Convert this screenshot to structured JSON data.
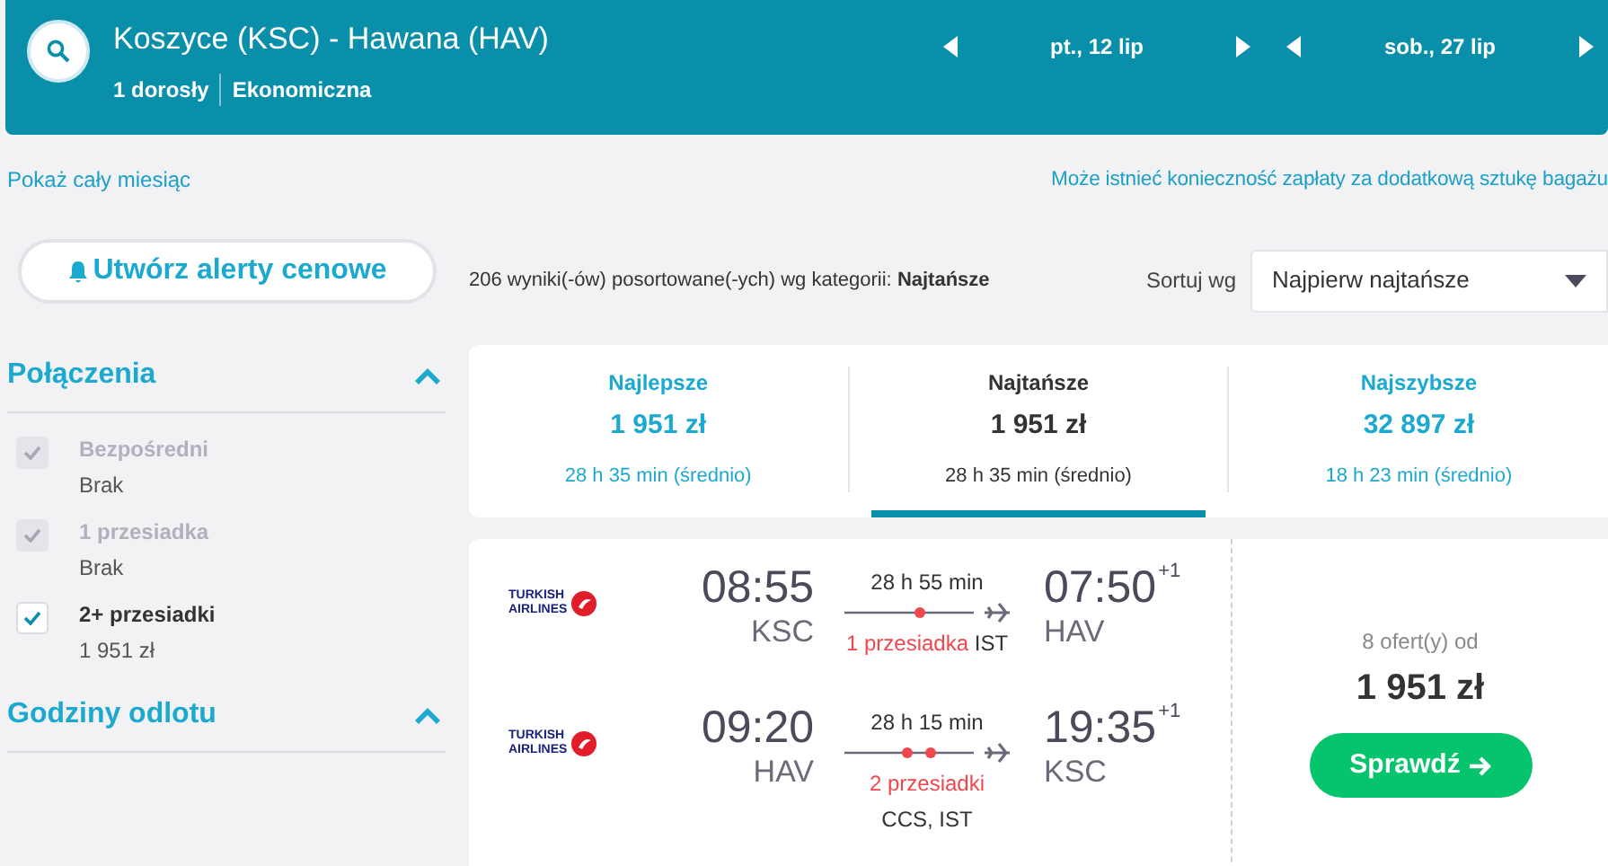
{
  "header": {
    "route": "Koszyce (KSC) - Hawana (HAV)",
    "passengers": "1 dorosły",
    "cabin": "Ekonomiczna",
    "dates": [
      {
        "label": "pt., 12 lip"
      },
      {
        "label": "sob., 27 lip"
      }
    ]
  },
  "links": {
    "month": "Pokaż cały miesiąc",
    "baggage": "Może istnieć konieczność zapłaty za dodatkową sztukę bagażu"
  },
  "alert_button": "Utwórz alerty cenowe",
  "filters": [
    {
      "title": "Połączenia",
      "expanded": true,
      "options": [
        {
          "label": "Bezpośredni",
          "price": "Brak",
          "checked": true,
          "disabled": true
        },
        {
          "label": "1 przesiadka",
          "price": "Brak",
          "checked": true,
          "disabled": true
        },
        {
          "label": "2+ przesiadki",
          "price": "1 951 zł",
          "checked": true,
          "disabled": false
        }
      ]
    },
    {
      "title": "Godziny odlotu",
      "expanded": true
    }
  ],
  "results": {
    "summary": "206 wyniki(-ów) posortowane(-ych) wg kategorii: **Najtańsze**",
    "sort_label": "Sortuj wg",
    "sort_value": "Najpierw najtańsze"
  },
  "sort_tabs": [
    {
      "label": "Najlepsze",
      "price": "1 951 zł",
      "duration": "28 h 35 min (średnio)",
      "selected": false
    },
    {
      "label": "Najtańsze",
      "price": "1 951 zł",
      "duration": "28 h 35 min (średnio)",
      "selected": true
    },
    {
      "label": "Najszybsze",
      "price": "32 897 zł",
      "duration": "18 h 23 min (średnio)",
      "selected": false
    }
  ],
  "flight": {
    "legs": [
      {
        "airline": [
          "TURKISH",
          "AIRLINES"
        ],
        "depart_time": "08:55",
        "depart_code": "KSC",
        "duration": "28 h 55 min",
        "stops": "1 przesiadka",
        "via": "IST",
        "kind": "inline",
        "arrive_time": "07:50",
        "day_offset": "+1",
        "arrive_code": "HAV"
      },
      {
        "airline": [
          "TURKISH",
          "AIRLINES"
        ],
        "depart_time": "09:20",
        "depart_code": "HAV",
        "duration": "28 h 15 min",
        "stops": "2 przesiadki",
        "via": "CCS, IST",
        "kind": "below",
        "arrive_time": "19:35",
        "day_offset": "+1",
        "arrive_code": "KSC"
      }
    ],
    "offers": "8 ofert(y) od",
    "price": "1 951 zł",
    "button": "Sprawdź"
  }
}
